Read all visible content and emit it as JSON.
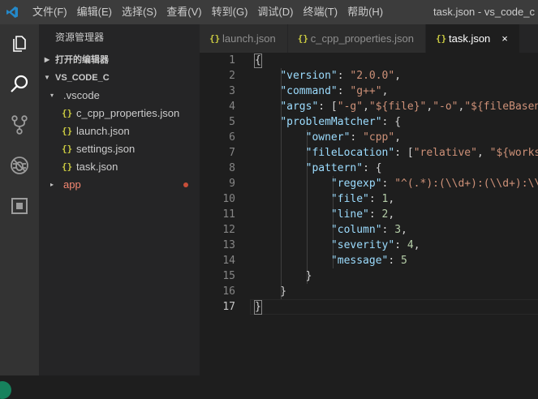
{
  "menu": [
    "文件(F)",
    "编辑(E)",
    "选择(S)",
    "查看(V)",
    "转到(G)",
    "调试(D)",
    "终端(T)",
    "帮助(H)"
  ],
  "window_title": "task.json - vs_code_c",
  "sidebar": {
    "title": "资源管理器",
    "open_editors": "打开的编辑器",
    "workspace": "VS_CODE_C",
    "folder_vscode": ".vscode",
    "files": [
      "c_cpp_properties.json",
      "launch.json",
      "settings.json",
      "task.json"
    ],
    "folder_app": "app"
  },
  "tabs": [
    {
      "label": "launch.json"
    },
    {
      "label": "c_cpp_properties.json"
    },
    {
      "label": "task.json",
      "close": "×"
    }
  ],
  "file_icon_glyph": "{}",
  "editor": {
    "line_numbers": [
      "1",
      "2",
      "3",
      "4",
      "5",
      "6",
      "7",
      "8",
      "9",
      "10",
      "11",
      "12",
      "13",
      "14",
      "15",
      "16",
      "17"
    ]
  },
  "colors": {
    "key": "#9cdcfe",
    "string": "#ce9178",
    "number": "#b5cea8",
    "json_icon": "#cbcb41",
    "app_folder": "#f48771"
  }
}
